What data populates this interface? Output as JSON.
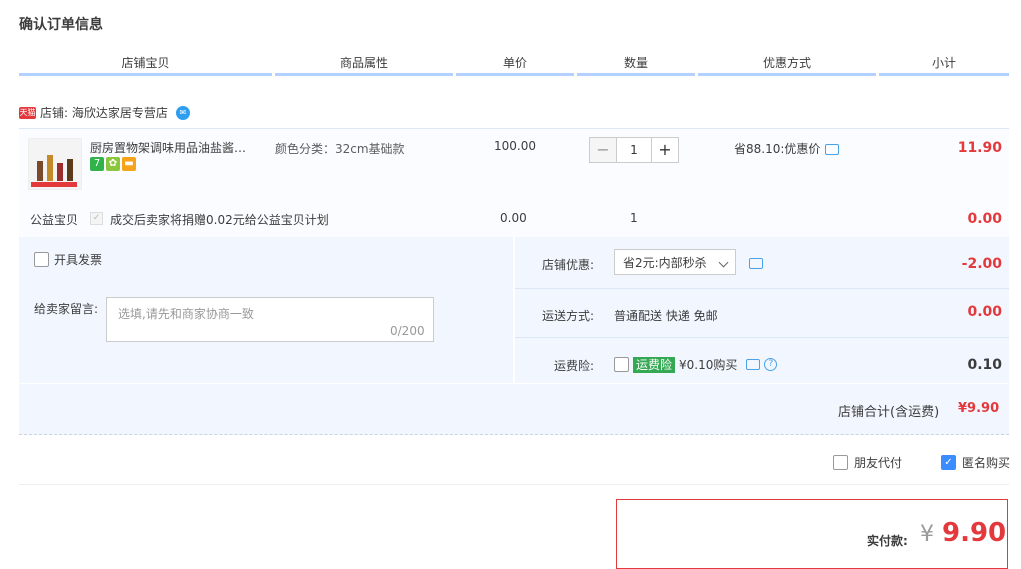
{
  "page_title": "确认订单信息",
  "columns": [
    "店铺宝贝",
    "商品属性",
    "单价",
    "数量",
    "优惠方式",
    "小计"
  ],
  "shop": {
    "badge": "天猫",
    "label": "店铺: 海欣达家居专营店"
  },
  "item": {
    "name": "厨房置物架调味用品油盐酱…",
    "attribute": "颜色分类：32cm基础款",
    "price": "100.00",
    "quantity": "1",
    "discount": "省88.10:优惠价",
    "subtotal": "11.90",
    "badges": [
      {
        "text": "7",
        "color": "#31b24a"
      },
      {
        "text": "✿",
        "color": "#8cc63f"
      },
      {
        "text": "▬",
        "color": "#f7a21b"
      }
    ]
  },
  "charity": {
    "label": "公益宝贝",
    "desc": "成交后卖家将捐赠0.02元给公益宝贝计划",
    "price": "0.00",
    "quantity": "1",
    "subtotal": "0.00"
  },
  "invoice_label": "开具发票",
  "message": {
    "label": "给卖家留言:",
    "placeholder": "选填,请先和商家协商一致",
    "count": "0/200"
  },
  "shop_discount": {
    "label": "店铺优惠:",
    "selected": "省2元:内部秒杀",
    "value": "-2.00"
  },
  "shipping": {
    "label": "运送方式:",
    "method": "普通配送 快递 免邮",
    "value": "0.00"
  },
  "insurance": {
    "label": "运费险:",
    "tag": "运费险",
    "price": "¥0.10购买",
    "value": "0.10"
  },
  "shop_total": {
    "label": "店铺合计(含运费)",
    "value": "¥9.90"
  },
  "options": {
    "friend_pay": "朋友代付",
    "anonymous": "匿名购买"
  },
  "payment": {
    "label": "实付款:",
    "currency": "¥",
    "amount": "9.90"
  },
  "colors": {
    "accent_red": "#e4393c",
    "header_line": "#b2d1ff",
    "panel_bg": "#f2f7ff"
  }
}
